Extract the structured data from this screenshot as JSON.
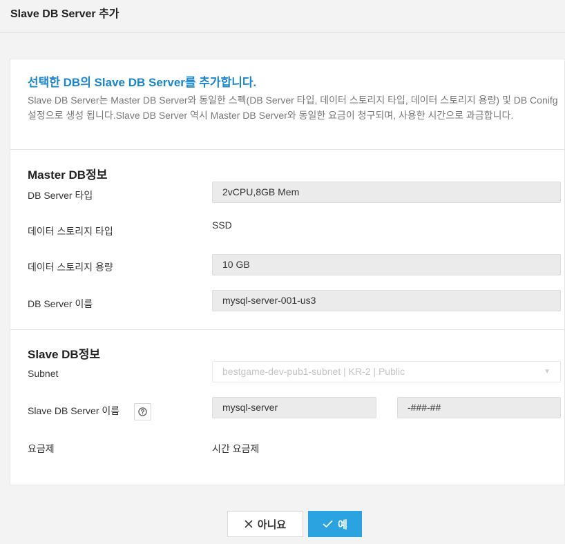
{
  "header": {
    "title": "Slave DB Server 추가"
  },
  "intro": {
    "title": "선택한 DB의 Slave DB Server를 추가합니다.",
    "description": "Slave DB Server는 Master DB Server와 동일한 스펙(DB Server 타입, 데이터 스토리지 타입, 데이터 스토리지 용량) 및 DB Conifg 설정으로 생성 됩니다.Slave DB Server 역시 Master DB Server와 동일한 요금이 청구되며, 사용한 시간으로 과금합니다."
  },
  "master": {
    "section_title": "Master DB정보",
    "server_type_label": "DB Server 타입",
    "server_type_value": "2vCPU,8GB Mem",
    "storage_type_label": "데이터 스토리지 타입",
    "storage_type_value": "SSD",
    "storage_size_label": "데이터 스토리지 용량",
    "storage_size_value": "10 GB",
    "server_name_label": "DB Server 이름",
    "server_name_value": "mysql-server-001-us3"
  },
  "slave": {
    "section_title": "Slave DB정보",
    "subnet_label": "Subnet",
    "subnet_value": "bestgame-dev-pub1-subnet | KR-2 | Public",
    "server_name_label": "Slave DB Server 이름",
    "server_name_prefix": "mysql-server",
    "server_name_suffix": "-###-##",
    "pricing_label": "요금제",
    "pricing_value": "시간 요금제"
  },
  "buttons": {
    "no_label": "아니요",
    "yes_label": "예"
  },
  "icons": {
    "help": "question-circle-icon",
    "dropdown": "caret-down-icon",
    "close": "close-icon",
    "check": "check-icon"
  },
  "colors": {
    "accent_blue": "#1a86d0",
    "confirm_button": "#2aa3e0",
    "readonly_field": "#ebebeb",
    "background": "#f3f3f3"
  }
}
